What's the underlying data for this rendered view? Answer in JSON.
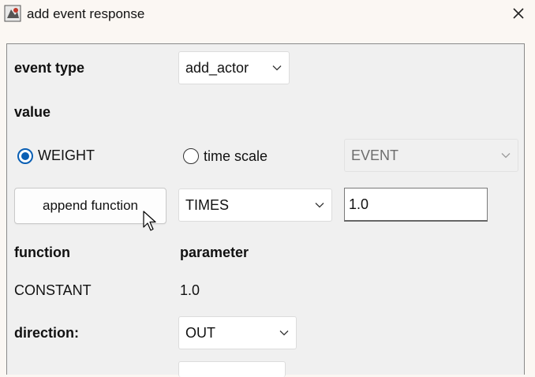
{
  "window": {
    "title": "add event response"
  },
  "event_type": {
    "label": "event type",
    "value": "add_actor"
  },
  "value_section": {
    "label": "value"
  },
  "radios": {
    "weight": {
      "label": "WEIGHT",
      "selected": true
    },
    "time_scale": {
      "label": "time scale",
      "selected": false
    }
  },
  "time_scale_combo": {
    "value": "EVENT"
  },
  "append": {
    "button_label": "append function",
    "operator_value": "TIMES",
    "param_value": "1.0"
  },
  "table": {
    "headers": {
      "function": "function",
      "parameter": "parameter"
    },
    "rows": [
      {
        "function": "CONSTANT",
        "parameter": "1.0"
      }
    ]
  },
  "direction": {
    "label": "direction:",
    "value": "OUT"
  },
  "colors": {
    "accent": "#0a5fb4",
    "panel": "#f0f0f0",
    "titlebar": "#fbf7f3"
  },
  "icons": {
    "app": "app-icon",
    "close": "close-icon",
    "chevron": "chevron-down-icon",
    "cursor": "mouse-pointer-icon"
  }
}
